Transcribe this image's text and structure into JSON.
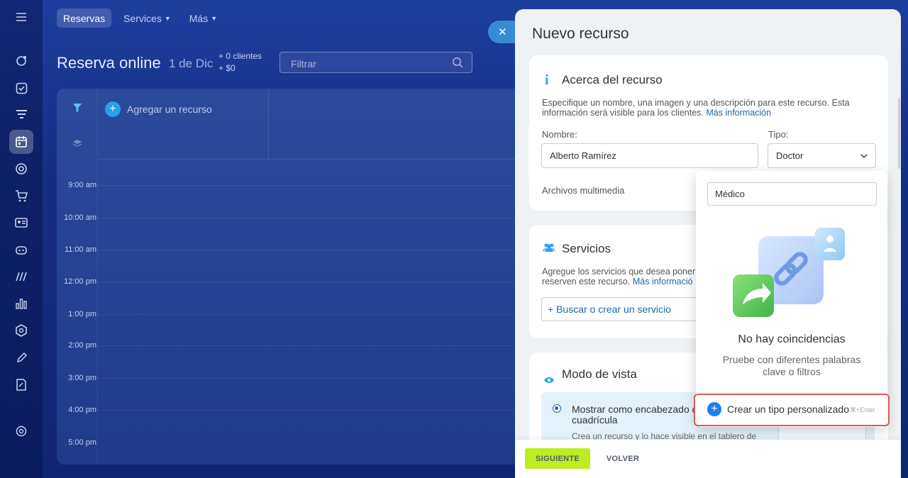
{
  "top_nav": {
    "tabs": [
      {
        "label": "Reservas",
        "active": true
      },
      {
        "label": "Services",
        "has_dropdown": true
      },
      {
        "label": "Más",
        "has_dropdown": true
      }
    ]
  },
  "page": {
    "title": "Reserva online",
    "date": "1 de Dic",
    "clients": "+ 0 clientes",
    "amount": "+ $0",
    "filter_placeholder": "Filtrar"
  },
  "calendar": {
    "add_resource": "Agregar un recurso",
    "times": [
      "9:00 am",
      "10:00 am",
      "11:00 am",
      "12:00 pm",
      "1:00 pm",
      "2:00 pm",
      "3:00 pm",
      "4:00 pm",
      "5:00 pm"
    ]
  },
  "panel": {
    "title": "Nuevo recurso",
    "about": {
      "title": "Acerca del recurso",
      "description": "Especifique un nombre, una imagen y una descripción para este recurso. Esta información será visible para los clientes.",
      "more_link": "Más información",
      "name_label": "Nombre:",
      "name_value": "Alberto Ramírez",
      "type_label": "Tipo:",
      "type_value": "Doctor",
      "media_label": "Archivos multimedia"
    },
    "services": {
      "title": "Servicios",
      "description": "Agregue los servicios que desea poner",
      "description2": "reserven este recurso.",
      "more_link": "Más informació",
      "search_button": "+ Buscar o crear un servicio"
    },
    "view_mode": {
      "title": "Modo de vista",
      "option_title": "Mostrar como encabezado d",
      "option_title2": "cuadrícula",
      "option_desc": "Crea un recurso y lo hace visible en el tablero de"
    },
    "footer": {
      "next": "SIGUIENTE",
      "back": "VOLVER"
    }
  },
  "dropdown": {
    "search_value": "Médico",
    "no_match_title": "No hay coincidencias",
    "no_match_sub": "Pruebe con diferentes palabras clave o filtros",
    "create_label": "Crear un tipo personalizado",
    "create_shortcut": "⌘+Enter"
  },
  "colors": {
    "accent": "#2fa5ee",
    "next_button": "#bbed21",
    "highlight": "#e05a50",
    "link": "#2067b0"
  }
}
